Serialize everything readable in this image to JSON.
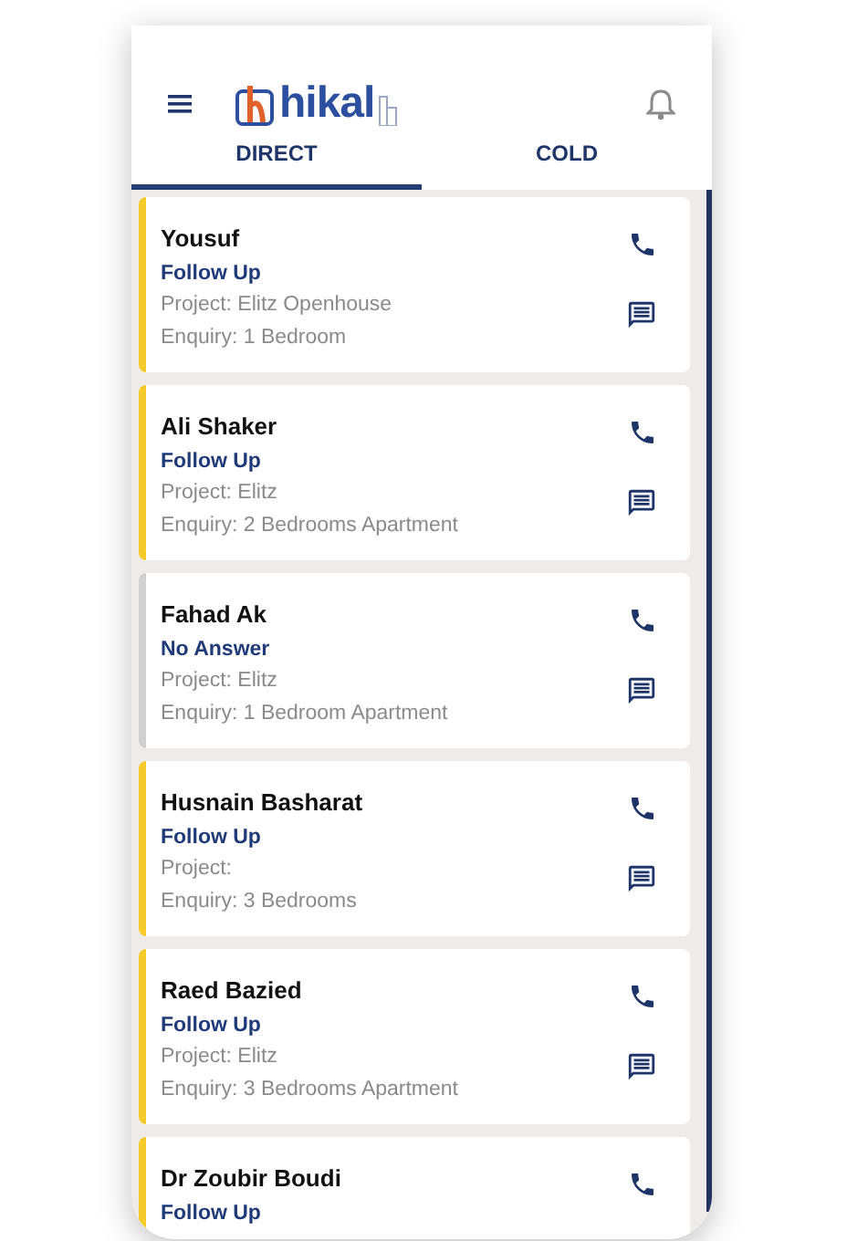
{
  "header": {
    "logo": "hikal"
  },
  "tabs": [
    {
      "label": "DIRECT",
      "selected": true
    },
    {
      "label": "COLD",
      "selected": false
    }
  ],
  "leads": [
    {
      "name": "Yousuf",
      "status": "Follow Up",
      "project": "Project: Elitz Openhouse",
      "enquiry": "Enquiry: 1 Bedroom",
      "color": "#f5cb2b"
    },
    {
      "name": "Ali Shaker",
      "status": "Follow Up",
      "project": "Project: Elitz",
      "enquiry": "Enquiry: 2 Bedrooms Apartment",
      "color": "#f5cb2b"
    },
    {
      "name": "Fahad Ak",
      "status": "No Answer",
      "project": "Project: Elitz",
      "enquiry": "Enquiry: 1 Bedroom Apartment",
      "color": "#d0d0d0"
    },
    {
      "name": "Husnain Basharat",
      "status": "Follow Up",
      "project": "Project:",
      "enquiry": "Enquiry: 3 Bedrooms",
      "color": "#f5cb2b"
    },
    {
      "name": "Raed Bazied",
      "status": "Follow Up",
      "project": "Project: Elitz",
      "enquiry": "Enquiry: 3 Bedrooms Apartment",
      "color": "#f5cb2b"
    },
    {
      "name": "Dr Zoubir Boudi",
      "status": "Follow Up",
      "color": "#f5cb2b"
    }
  ]
}
